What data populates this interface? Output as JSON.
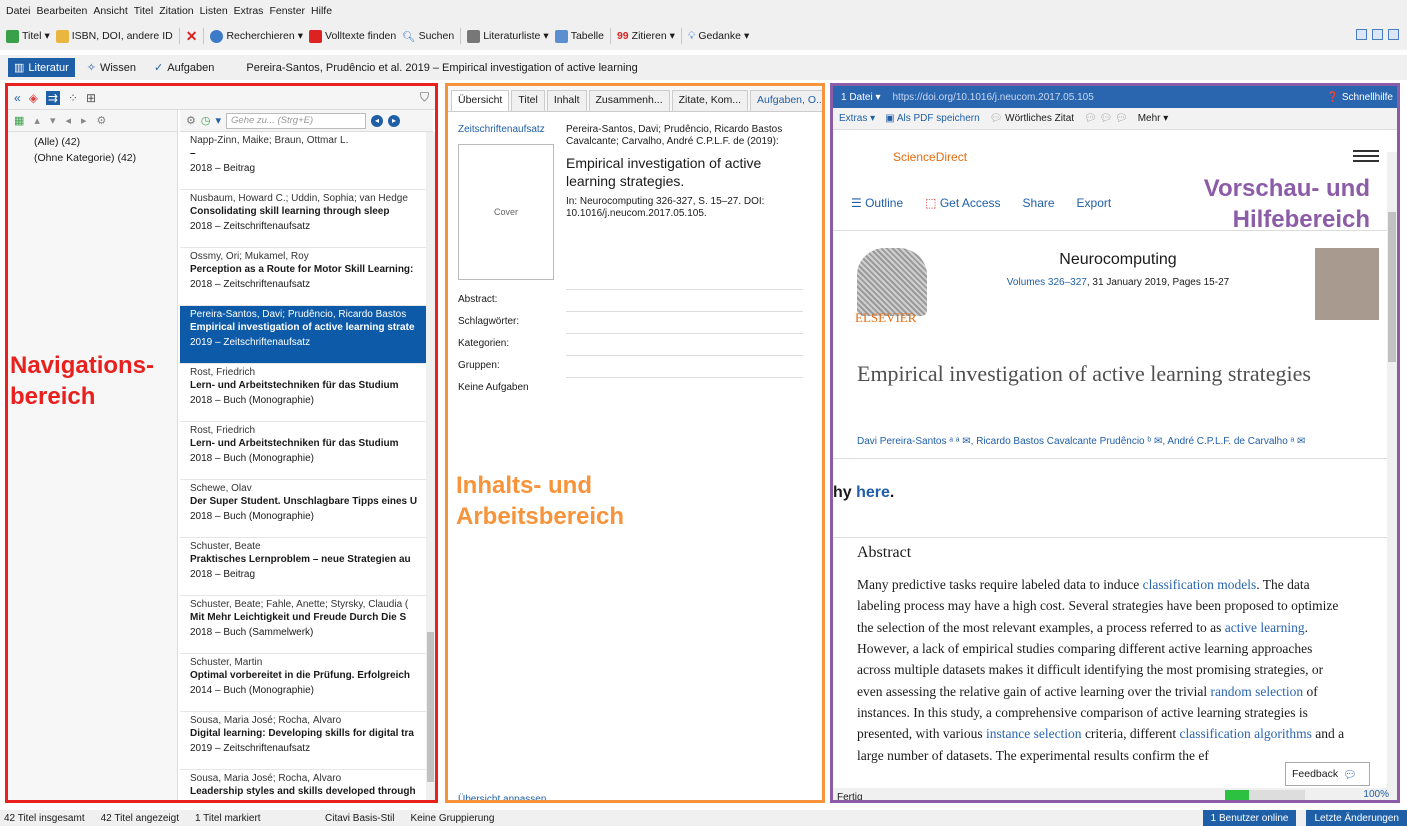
{
  "menu": [
    "Datei",
    "Bearbeiten",
    "Ansicht",
    "Titel",
    "Zitation",
    "Listen",
    "Extras",
    "Fenster",
    "Hilfe"
  ],
  "toolbar": {
    "title_btn": "Titel",
    "isbn_btn": "ISBN, DOI, andere ID",
    "research_btn": "Recherchieren",
    "fulltext_btn": "Volltexte finden",
    "search_btn": "Suchen",
    "biblist_btn": "Literaturliste",
    "table_btn": "Tabelle",
    "cite_btn": "Zitieren",
    "thought_btn": "Gedanke"
  },
  "modes": {
    "literature": "Literatur",
    "knowledge": "Wissen",
    "tasks": "Aufgaben",
    "current_title": "Pereira-Santos, Prudêncio et al. 2019 – Empirical investigation of active learning"
  },
  "nav": {
    "categories": [
      "(Alle) (42)",
      "(Ohne Kategorie) (42)"
    ],
    "goto_placeholder": "Gehe zu... (Strg+E)",
    "items": [
      {
        "authors": "Napp-Zinn, Maike; Braun, Ottmar L.",
        "title": "–",
        "type": "2018 – Beitrag"
      },
      {
        "authors": "Nusbaum, Howard C.; Uddin, Sophia; van Hedge",
        "title": "Consolidating skill learning through sleep",
        "type": "2018 – Zeitschriftenaufsatz"
      },
      {
        "authors": "Ossmy, Ori; Mukamel, Roy",
        "title": "Perception as a Route for Motor Skill Learning:",
        "type": "2018 – Zeitschriftenaufsatz"
      },
      {
        "authors": "Pereira-Santos, Davi; Prudêncio, Ricardo Bastos",
        "title": "Empirical investigation of active learning strate",
        "type": "2019 – Zeitschriftenaufsatz"
      },
      {
        "authors": "Rost, Friedrich",
        "title": "Lern- und Arbeitstechniken für das Studium",
        "type": "2018 – Buch (Monographie)"
      },
      {
        "authors": "Rost, Friedrich",
        "title": "Lern- und Arbeitstechniken für das Studium",
        "type": "2018 – Buch (Monographie)"
      },
      {
        "authors": "Schewe, Olav",
        "title": "Der Super Student. Unschlagbare Tipps eines Ü",
        "type": "2018 – Buch (Monographie)"
      },
      {
        "authors": "Schuster, Beate",
        "title": "Praktisches Lernproblem – neue Strategien au",
        "type": "2018 – Beitrag"
      },
      {
        "authors": "Schuster, Beate; Fahle, Anette; Styrsky, Claudia (",
        "title": "Mit Mehr Leichtigkeit und Freude Durch Die S",
        "type": "2018 – Buch (Sammelwerk)"
      },
      {
        "authors": "Schuster, Martin",
        "title": "Optimal vorbereitet in die Prüfung. Erfolgreich",
        "type": "2014 – Buch (Monographie)"
      },
      {
        "authors": "Sousa, Maria José; Rocha, Álvaro",
        "title": "Digital learning: Developing skills for digital tra",
        "type": "2019 – Zeitschriftenaufsatz"
      },
      {
        "authors": "Sousa, Maria José; Rocha, Álvaro",
        "title": "Leadership styles and skills developed through",
        "type": "2019 – Zeitschriftenaufsatz"
      }
    ],
    "selected_index": 3
  },
  "middle": {
    "tabs": [
      "Übersicht",
      "Titel",
      "Inhalt",
      "Zusammenh...",
      "Zitate, Kom...",
      "Aufgaben, O..."
    ],
    "doc_type": "Zeitschriftenaufsatz",
    "cite_authors": "Pereira-Santos, Davi; Prudêncio, Ricardo Bastos Cavalcante; Carvalho, André C.P.L.F. de (2019):",
    "cite_title": "Empirical investigation of active learning strategies.",
    "cite_in": "In: Neurocomputing 326-327, S. 15–27. DOI: 10.1016/j.neucom.2017.05.105.",
    "cover": "Cover",
    "fields": [
      "Abstract:",
      "Schlagwörter:",
      "Kategorien:",
      "Gruppen:",
      "Keine Aufgaben"
    ],
    "customize": "Übersicht anpassen..."
  },
  "right": {
    "file_btn": "1 Datei",
    "url": "https://doi.org/10.1016/j.neucom.2017.05.105",
    "help": "Schnellhilfe",
    "extras": "Extras",
    "save_pdf": "Als PDF speichern",
    "quote": "Wörtliches Zitat",
    "more": "Mehr",
    "sciencedirect": "ScienceDirect",
    "nav_links": [
      "Outline",
      "Get Access",
      "Share",
      "Export"
    ],
    "journal": "Neurocomputing",
    "volume_link": "Volumes 326–327",
    "volume_rest": ", 31 January 2019, Pages 15-27",
    "elsevier": "ELSEVIER",
    "article_title": "Empirical investigation of active learning strategies",
    "authors": "Davi Pereira-Santos ᵃ ᵃ ✉, Ricardo Bastos Cavalcante Prudêncio ᵇ ✉, André C.P.L.F. de Carvalho ᵃ ✉",
    "banner_pre": "hy ",
    "banner_link": "here",
    "banner_post": ".",
    "abstract_heading": "Abstract",
    "abstract_parts": [
      {
        "t": "Many predictive tasks require labeled data to induce ",
        "l": false
      },
      {
        "t": "classification models",
        "l": true
      },
      {
        "t": ". The data labeling process may have a high cost. Several strategies have been proposed to optimize the selection of the most relevant examples, a process referred to as ",
        "l": false
      },
      {
        "t": "active learning",
        "l": true
      },
      {
        "t": ". However, a lack of empirical studies comparing different active learning approaches across multiple datasets makes it difficult identifying the most promising strategies, or even assessing the relative gain of active learning over the trivial ",
        "l": false
      },
      {
        "t": "random selection",
        "l": true
      },
      {
        "t": " of instances. In this study, a comprehensive comparison of active learning strategies is presented, with various ",
        "l": false
      },
      {
        "t": "instance selection",
        "l": true
      },
      {
        "t": " criteria, different ",
        "l": false
      },
      {
        "t": "classification algorithms",
        "l": true
      },
      {
        "t": " and a large number of datasets. The experimental results confirm the ef",
        "l": false
      }
    ],
    "feedback": "Feedback",
    "status": "Fertig",
    "zoom": "100%",
    "progress_fraction": 0.3
  },
  "labels": {
    "nav": [
      "Navigations-",
      "bereich"
    ],
    "mid": [
      "Inhalts- und",
      "Arbeitsbereich"
    ],
    "right": [
      "Vorschau- und",
      "Hilfebereich"
    ]
  },
  "statusbar": {
    "total": "42 Titel insgesamt",
    "shown": "42 Titel angezeigt",
    "marked": "1 Titel markiert",
    "style": "Citavi Basis-Stil",
    "grouping": "Keine Gruppierung",
    "online": "1 Benutzer online",
    "changes": "Letzte Änderungen"
  },
  "colors": {
    "nav_border": "#e8201e",
    "mid_border": "#f7933a",
    "right_border": "#8c5ca8",
    "accent": "#1f5fa8"
  }
}
